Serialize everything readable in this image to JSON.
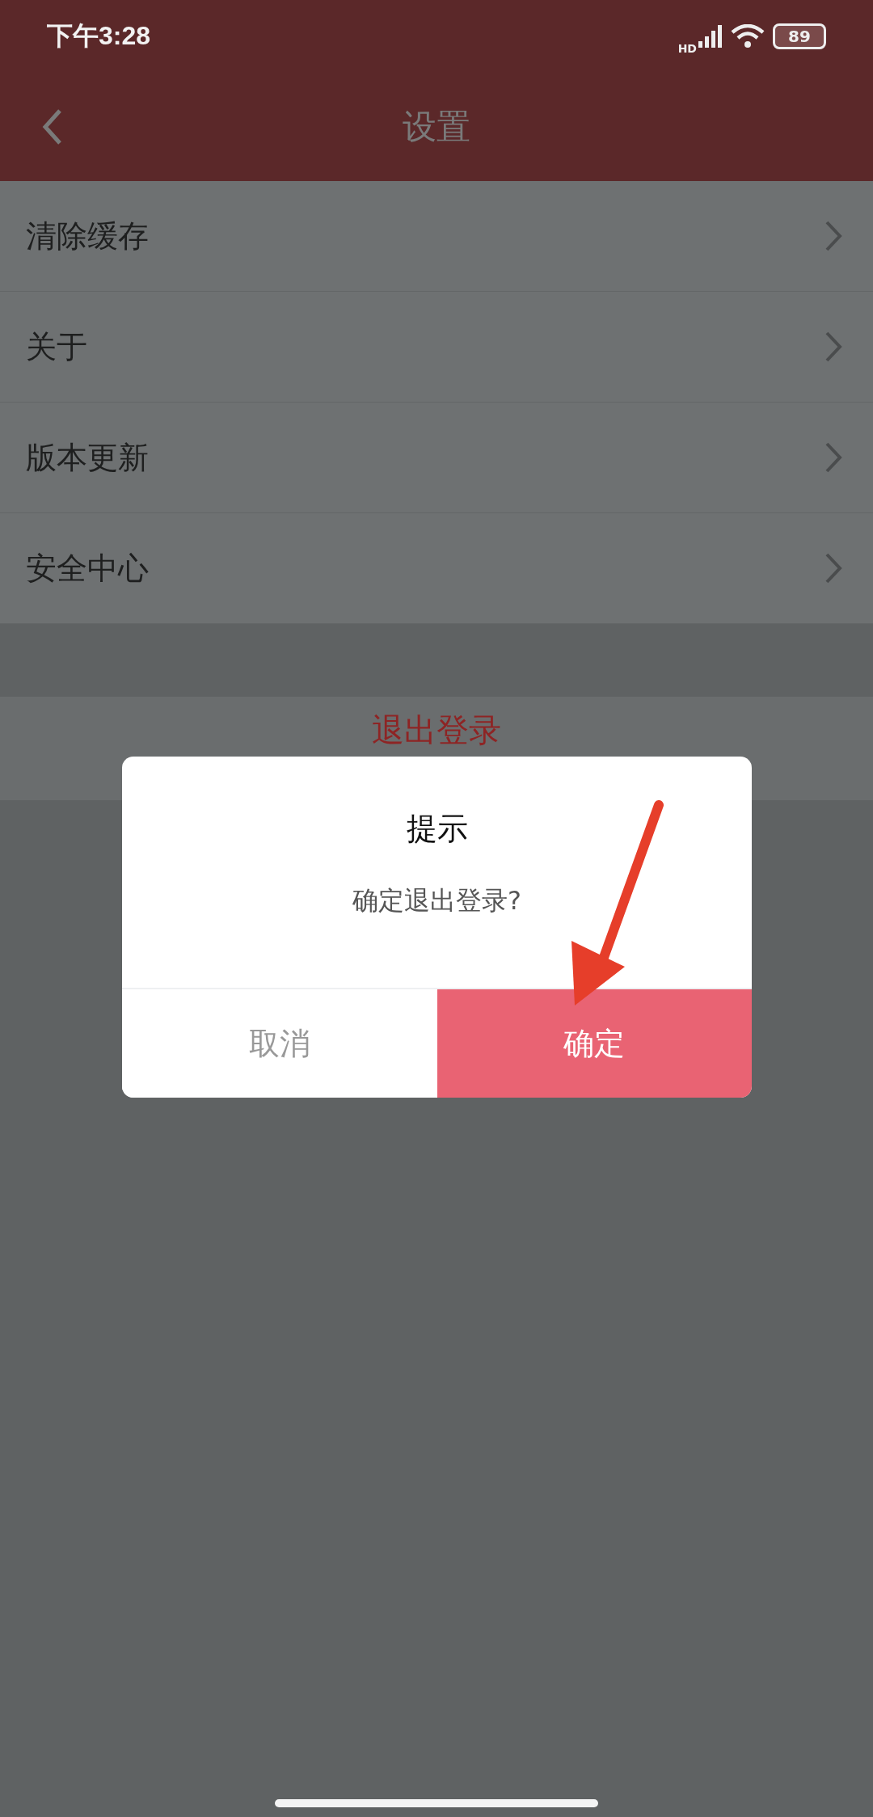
{
  "status_bar": {
    "time": "下午3:28",
    "network": "HD",
    "battery": "89"
  },
  "header": {
    "title": "设置"
  },
  "menu": [
    {
      "label": "清除缓存"
    },
    {
      "label": "关于"
    },
    {
      "label": "版本更新"
    },
    {
      "label": "安全中心"
    }
  ],
  "logout_button": "退出登录",
  "dialog": {
    "title": "提示",
    "message": "确定退出登录?",
    "buttons": [
      {
        "label": "取消",
        "kind": "cancel"
      },
      {
        "label": "确定",
        "kind": "confirm"
      }
    ]
  }
}
